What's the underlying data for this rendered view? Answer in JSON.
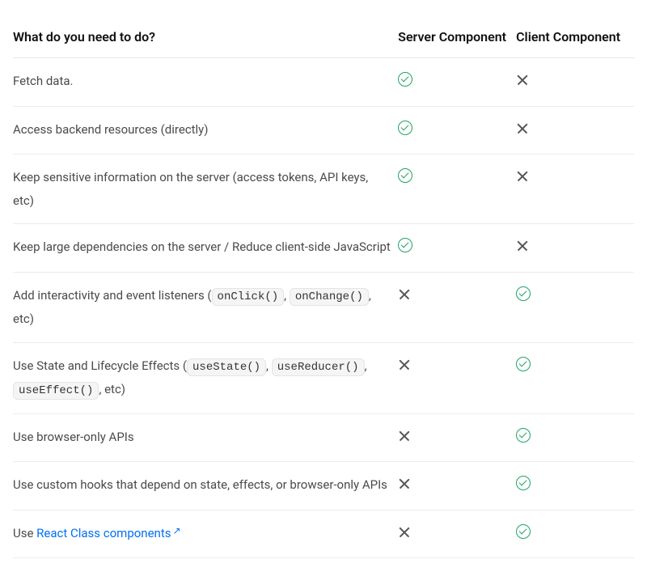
{
  "headers": {
    "col1": "What do you need to do?",
    "col2": "Server Component",
    "col3": "Client Component"
  },
  "rows": [
    {
      "segments": [
        {
          "type": "text",
          "value": "Fetch data."
        }
      ],
      "server": "check",
      "client": "cross"
    },
    {
      "segments": [
        {
          "type": "text",
          "value": "Access backend resources (directly)"
        }
      ],
      "server": "check",
      "client": "cross"
    },
    {
      "segments": [
        {
          "type": "text",
          "value": "Keep sensitive information on the server (access tokens, API keys, etc)"
        }
      ],
      "server": "check",
      "client": "cross"
    },
    {
      "segments": [
        {
          "type": "text",
          "value": "Keep large dependencies on the server / Reduce client-side JavaScript"
        }
      ],
      "server": "check",
      "client": "cross"
    },
    {
      "segments": [
        {
          "type": "text",
          "value": "Add interactivity and event listeners ("
        },
        {
          "type": "code",
          "value": "onClick()"
        },
        {
          "type": "text",
          "value": ", "
        },
        {
          "type": "code",
          "value": "onChange()"
        },
        {
          "type": "text",
          "value": ", etc)"
        }
      ],
      "server": "cross",
      "client": "check"
    },
    {
      "segments": [
        {
          "type": "text",
          "value": "Use State and Lifecycle Effects ("
        },
        {
          "type": "code",
          "value": "useState()"
        },
        {
          "type": "text",
          "value": ", "
        },
        {
          "type": "code",
          "value": "useReducer()"
        },
        {
          "type": "text",
          "value": ", "
        },
        {
          "type": "code",
          "value": "useEffect()"
        },
        {
          "type": "text",
          "value": ", etc)"
        }
      ],
      "server": "cross",
      "client": "check"
    },
    {
      "segments": [
        {
          "type": "text",
          "value": "Use browser-only APIs"
        }
      ],
      "server": "cross",
      "client": "check"
    },
    {
      "segments": [
        {
          "type": "text",
          "value": "Use custom hooks that depend on state, effects, or browser-only APIs"
        }
      ],
      "server": "cross",
      "client": "check"
    },
    {
      "segments": [
        {
          "type": "text",
          "value": "Use "
        },
        {
          "type": "link",
          "value": "React Class components"
        }
      ],
      "server": "cross",
      "client": "check"
    }
  ]
}
